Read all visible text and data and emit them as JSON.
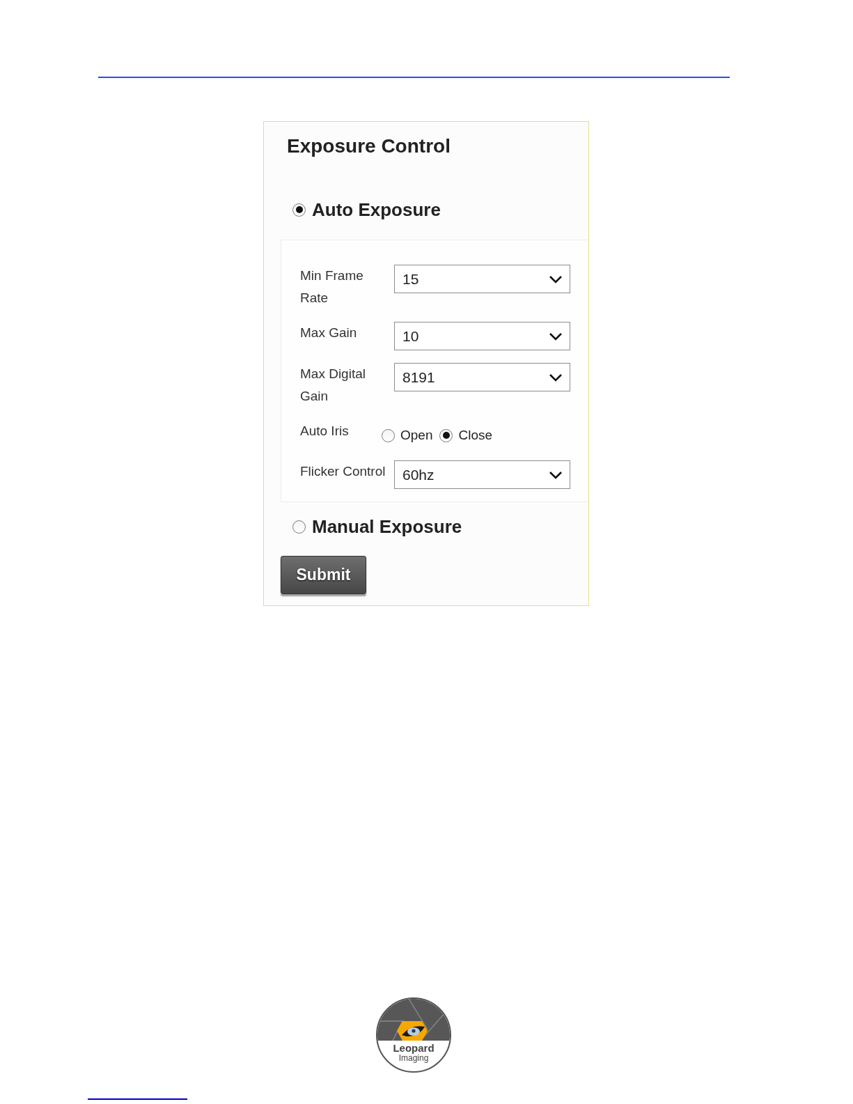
{
  "panel": {
    "title": "Exposure Control",
    "modes": [
      {
        "label": "Auto Exposure",
        "selected": true,
        "settings": [
          {
            "kind": "select",
            "label": "Min Frame Rate",
            "value": "15"
          },
          {
            "kind": "select",
            "label": "Max Gain",
            "value": "10"
          },
          {
            "kind": "select",
            "label": "Max Digital Gain",
            "value": "8191"
          },
          {
            "kind": "radio",
            "label": "Auto Iris",
            "options": [
              {
                "label": "Open",
                "selected": false
              },
              {
                "label": "Close",
                "selected": true
              }
            ]
          },
          {
            "kind": "select",
            "label": "Flicker Control",
            "value": "60hz"
          }
        ]
      },
      {
        "label": "Manual Exposure",
        "selected": false
      }
    ],
    "submit_button": "Submit"
  },
  "logo": {
    "name": "Leopard",
    "subtitle": "Imaging"
  }
}
